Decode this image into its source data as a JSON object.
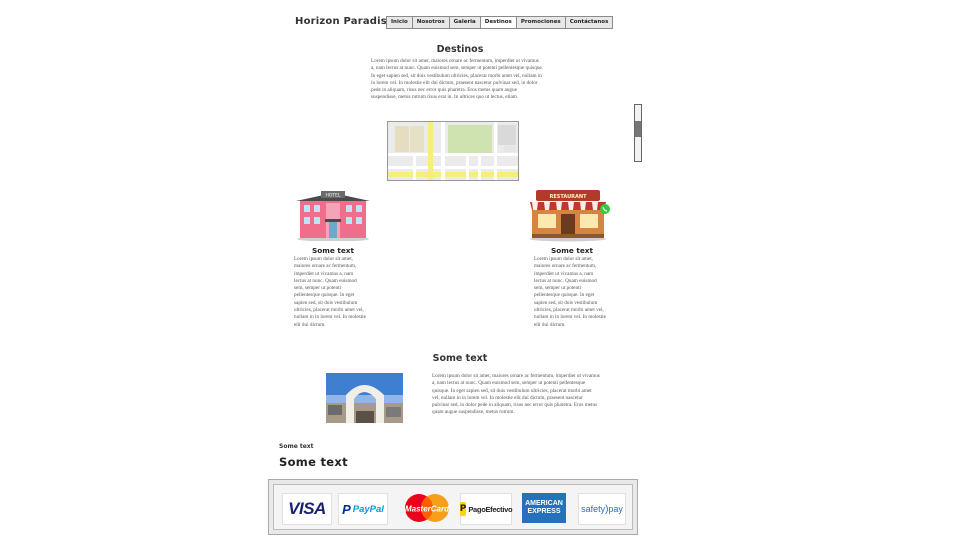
{
  "header": {
    "brand": "Horizon Paradise",
    "tabs": [
      {
        "label": "Inicio"
      },
      {
        "label": "Nosotros"
      },
      {
        "label": "Galeria"
      },
      {
        "label": "Destinos",
        "active": true
      },
      {
        "label": "Promociones"
      },
      {
        "label": "Contáctanos"
      }
    ]
  },
  "main": {
    "title": "Destinos",
    "paragraph": "Lorem ipsum dolor sit amet, maiores ornare ac fermentum, imperdiet ut vivamus a, nam lectus at nunc. Quam euismod sem, semper ut potenti pellentesque quisque. In eget sapien sed, sit duis vestibulum ultricies, placerat morbi amet vel, nullam in in lorem vel. In molestie elit dui dictum, praesent nascetur pulvinar sed, in dolor pede in aliquam, risus nec error quis pharetra. Eros metus quam augue suspendisse, metus rutrum risus erat in. In ultrices quo ut lectus, etiam."
  },
  "cards": [
    {
      "title": "Some text",
      "text": "Lorem ipsum dolor sit amet, maiores ornare ac fermentum, imperdiet ut vivamus a, nam lectus at nunc. Quam euismod sem, semper ut potenti pellentesque quisque. In eget sapien sed, sit duis vestibulum ultricies, placerat morbi amet vel, nullam in in lorem vel. In molestie elit dui dictum."
    },
    {
      "title": "Some text",
      "text": "Lorem ipsum dolor sit amet, maiores ornare ac fermentum, imperdiet ut vivamus a, nam lectus at nunc. Quam euismod sem, semper ut potenti pellentesque quisque. In eget sapien sed, sit duis vestibulum ultricies, placerat morbi amet vel, nullam in in lorem vel. In molestie elit dui dictum."
    }
  ],
  "hotel_sign": "HOTEL",
  "restaurant_sign": "RESTAURANT",
  "feature": {
    "title": "Some text",
    "text": "Lorem ipsum dolor sit amet, maiores ornare ac fermentum, imperdiet ut vivamus a, nam lectus at nunc. Quam euismod sem, semper ut potenti pellentesque quisque. In eget sapien sed, sit duis vestibulum ultricies, placerat morbi amet vel, nullam in in lorem vel. In molestie elit dui dictum, praesent nascetur pulvinar sed, in dolor pede in aliquam, risus nec error quis pharetra. Eros metus quam augue suspendisse, metus rutrum."
  },
  "footer": {
    "small_label": "Some text",
    "big_label": "Some text"
  },
  "payments": [
    {
      "name": "VISA",
      "icon": "visa-logo"
    },
    {
      "name": "PayPal",
      "icon": "paypal-logo"
    },
    {
      "name": "MasterCard",
      "icon": "mastercard-logo"
    },
    {
      "name": "PagoEfectivo",
      "icon": "pagoefectivo-logo"
    },
    {
      "name": "AMERICAN",
      "name2": "EXPRESS",
      "icon": "amex-logo"
    },
    {
      "name": "safety",
      "name2": "pay",
      "icon": "safetypay-logo"
    }
  ],
  "colors": {
    "nav_bg": "#e8e8e8",
    "visa_blue": "#1a1f71",
    "paypal_blue": "#003087",
    "paypal_light": "#009cde",
    "mc_red": "#eb001b",
    "mc_orange": "#f79e1b",
    "amex_blue": "#2671b9",
    "pago_yellow": "#ffd400",
    "map_yellow": "#f6ee7a",
    "map_green": "#cfe3b1"
  }
}
